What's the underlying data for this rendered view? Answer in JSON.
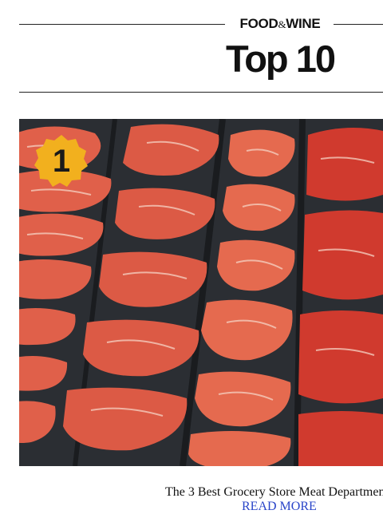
{
  "brand": {
    "food": "FOOD",
    "amp": "&",
    "wine": "WINE"
  },
  "headline": "Top 10",
  "feature": {
    "rank": "1",
    "image_alt": "raw-steaks-in-meat-case",
    "title": "The 3 Best Grocery Store Meat Departmen",
    "read_more": "READ MORE"
  },
  "colors": {
    "badge": "#f2b01e",
    "link": "#2a45c9",
    "text": "#111111"
  }
}
